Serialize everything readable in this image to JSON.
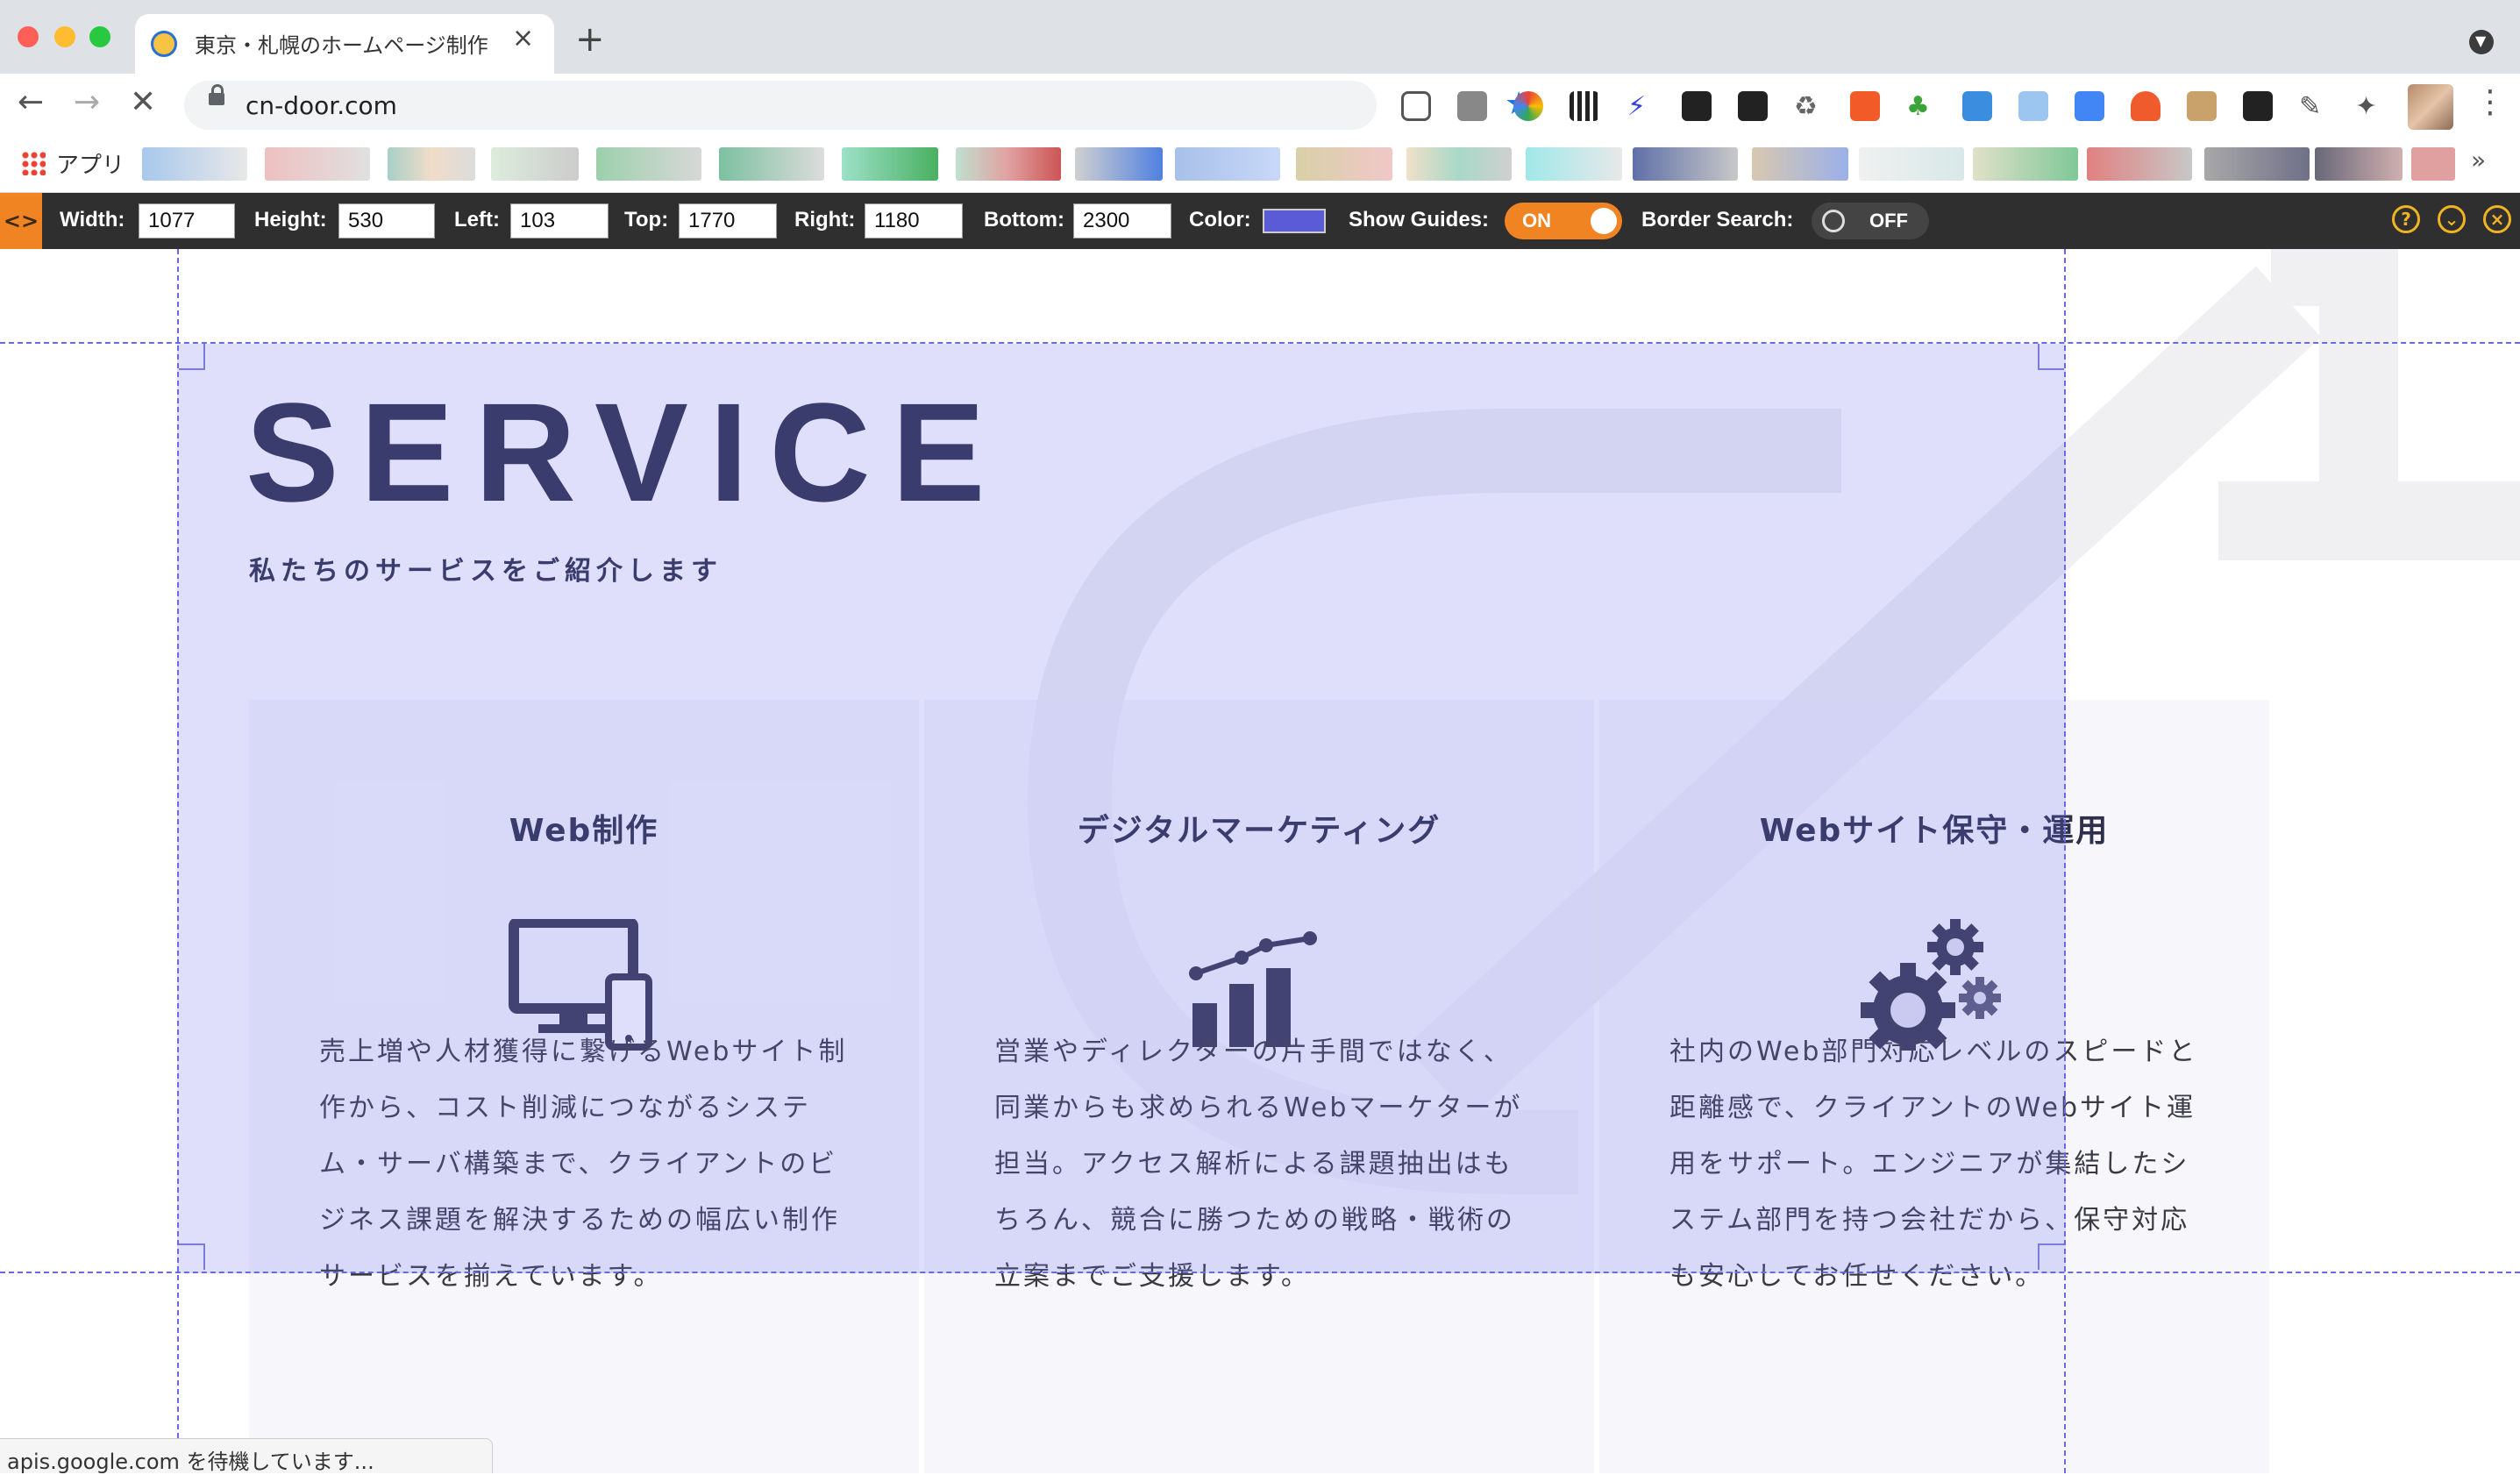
{
  "browser": {
    "tab": {
      "title": "東京・札幌のホームページ制作"
    },
    "address": {
      "url": "cn-door.com"
    },
    "bookmarks": {
      "apps_label": "アプリ",
      "more": "»"
    }
  },
  "measure_tool": {
    "width": {
      "label": "Width:",
      "value": "1077"
    },
    "height": {
      "label": "Height:",
      "value": "530"
    },
    "left": {
      "label": "Left:",
      "value": "103"
    },
    "top": {
      "label": "Top:",
      "value": "1770"
    },
    "right": {
      "label": "Right:",
      "value": "1180"
    },
    "bottom": {
      "label": "Bottom:",
      "value": "2300"
    },
    "color": {
      "label": "Color:",
      "value": "#5b5bd6"
    },
    "show_guides": {
      "label": "Show Guides:",
      "state": "ON"
    },
    "border_search": {
      "label": "Border Search:",
      "state": "OFF"
    },
    "help_icon": "?",
    "collapse_icon": "⌄",
    "close_icon": "×"
  },
  "page": {
    "heading": "SERVICE",
    "subheading": "私たちのサービスをご紹介します",
    "cards": [
      {
        "title": "Web制作",
        "icon": "devices-icon",
        "lines": [
          "売上増や人材獲得に繋げるWebサイト制",
          "作から、コスト削減につながるシステ",
          "ム・サーバ構築まで、クライアントのビ",
          "ジネス課題を解決するための幅広い制作",
          "サービスを揃えています。"
        ]
      },
      {
        "title": "デジタルマーケティング",
        "icon": "growth-chart-icon",
        "lines": [
          "営業やディレクターの片手間ではなく、",
          "同業からも求められるWebマーケターが",
          "担当。アクセス解析による課題抽出はも",
          "ちろん、競合に勝つための戦略・戦術の",
          "立案までご支援します。"
        ]
      },
      {
        "title": "Webサイト保守・運用",
        "icon": "gears-icon",
        "lines": [
          "社内のWeb部門対応レベルのスピードと",
          "距離感で、クライアントのWebサイト運",
          "用をサポート。エンジニアが集結したシ",
          "ステム部門を持つ会社だから、保守対応",
          "も安心してお任せください。"
        ]
      }
    ]
  },
  "status_bar": {
    "text": "apis.google.com を待機しています..."
  }
}
